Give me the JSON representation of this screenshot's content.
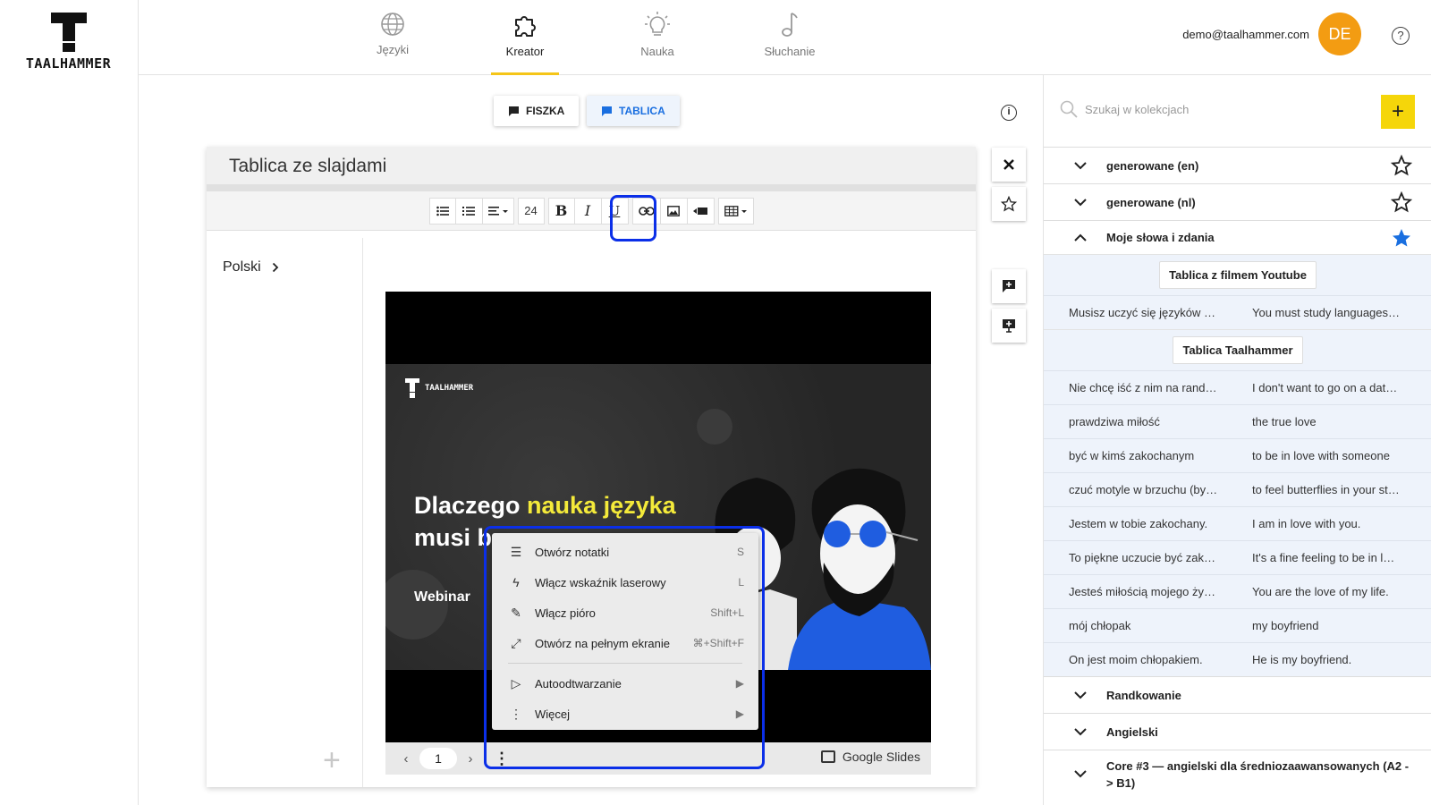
{
  "brand": {
    "name": "TAALHAMMER"
  },
  "nav": {
    "items": [
      {
        "label": "Języki",
        "icon": "globe-icon"
      },
      {
        "label": "Kreator",
        "icon": "puzzle-icon",
        "active": true
      },
      {
        "label": "Nauka",
        "icon": "lightbulb-icon"
      },
      {
        "label": "Słuchanie",
        "icon": "music-note-icon"
      }
    ]
  },
  "user": {
    "email": "demo@taalhammer.com",
    "initials": "DE"
  },
  "modes": {
    "fiszka": "FISZKA",
    "tablica": "TABLICA",
    "active": "TABLICA"
  },
  "editor": {
    "title": "Tablica ze slajdami",
    "font_size": "24",
    "language": "Polski"
  },
  "slide": {
    "logo_text": "TAALHAMMER",
    "headline_pre": "Dlaczego ",
    "headline_highlight": "nauka języka",
    "headline_post": "musi b",
    "subtitle": "Webinar",
    "page": "1",
    "provider": "Google Slides"
  },
  "menu": {
    "items": [
      {
        "label": "Otwórz notatki",
        "shortcut": "S",
        "icon": "notes-icon"
      },
      {
        "label": "Włącz wskaźnik laserowy",
        "shortcut": "L",
        "icon": "laser-icon"
      },
      {
        "label": "Włącz pióro",
        "shortcut": "Shift+L",
        "icon": "pen-icon"
      },
      {
        "label": "Otwórz na pełnym ekranie",
        "shortcut": "⌘+Shift+F",
        "icon": "fullscreen-icon"
      }
    ],
    "submenus": [
      {
        "label": "Autoodtwarzanie",
        "arrow": "▶",
        "icon": "play-icon"
      },
      {
        "label": "Więcej",
        "arrow": "▶",
        "icon": "more-vertical-icon"
      }
    ]
  },
  "search": {
    "placeholder": "Szukaj w kolekcjach"
  },
  "collections": {
    "top": [
      {
        "name": "generowane (en)",
        "starred": false
      },
      {
        "name": "generowane (nl)",
        "starred": false
      },
      {
        "name": "Moje słowa i zdania",
        "starred": true,
        "expanded": true
      }
    ],
    "boards": [
      {
        "title": "Tablica z filmem Youtube",
        "pairs": [
          {
            "pl": "Musisz uczyć się języków …",
            "en": "You must study languages…"
          }
        ]
      },
      {
        "title": "Tablica Taalhammer",
        "pairs": [
          {
            "pl": "Nie chcę iść z nim na rand…",
            "en": "I don't want to go on a dat…"
          },
          {
            "pl": "prawdziwa miłość",
            "en": "the true love"
          },
          {
            "pl": "być w kimś zakochanym",
            "en": "to be in love with someone"
          },
          {
            "pl": "czuć motyle w brzuchu (by…",
            "en": "to feel butterflies in your st…"
          },
          {
            "pl": "Jestem w tobie zakochany.",
            "en": "I am in love with you."
          },
          {
            "pl": "To piękne uczucie być zak…",
            "en": "It's a fine feeling to be in l…"
          },
          {
            "pl": "Jesteś miłością mojego ży…",
            "en": "You are the love of my life."
          },
          {
            "pl": "mój chłopak",
            "en": "my boyfriend"
          },
          {
            "pl": "On jest moim chłopakiem.",
            "en": "He is my boyfriend."
          }
        ]
      }
    ],
    "bottom": [
      {
        "name": "Randkowanie"
      },
      {
        "name": "Angielski"
      },
      {
        "name": "Core #3 — angielski dla średniozaawansowanych (A2 -> B1)"
      }
    ]
  },
  "colors": {
    "accent": "#f5c518",
    "active_blue": "#1a6fe0",
    "highlight": "#0b2fe8",
    "star_fill": "#1a6fe0",
    "avatar": "#f39c12"
  }
}
